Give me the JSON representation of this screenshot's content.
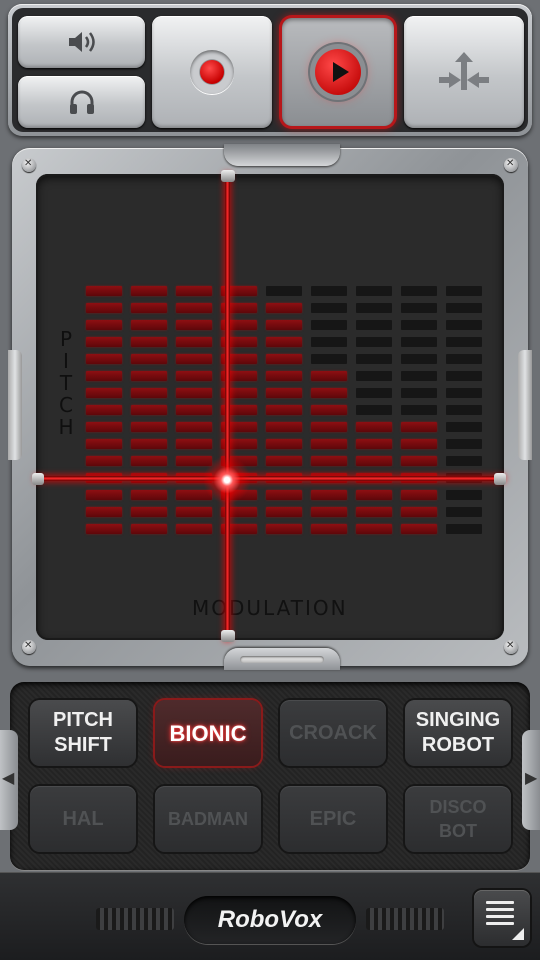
{
  "app": {
    "name": "RoboVox"
  },
  "topbar": {
    "speaker_icon": "speaker-icon",
    "headphones_icon": "headphones-icon",
    "record_icon": "record-icon",
    "play_icon": "play-icon",
    "move_icon": "move-arrows-icon",
    "play_active": true
  },
  "pad": {
    "y_axis_label": "PITCH",
    "x_axis_label": "MODULATION",
    "crosshair": {
      "modulation": 0.41,
      "pitch": 0.35
    },
    "accent_color": "#e01515"
  },
  "equalizer": {
    "columns": 9,
    "rows": 15,
    "levels": [
      15,
      15,
      15,
      15,
      14,
      10,
      7,
      7,
      0
    ]
  },
  "effects": [
    {
      "label": "PITCH\nSHIFT",
      "state": "enabled"
    },
    {
      "label": "BIONIC",
      "state": "selected"
    },
    {
      "label": "CROACK",
      "state": "disabled"
    },
    {
      "label": "SINGING\nROBOT",
      "state": "enabled"
    },
    {
      "label": "HAL",
      "state": "disabled"
    },
    {
      "label": "BADMAN",
      "state": "disabled"
    },
    {
      "label": "EPIC",
      "state": "disabled"
    },
    {
      "label": "DISCO\nBOT",
      "state": "disabled"
    }
  ],
  "bottombar": {
    "logo": "RoboVox",
    "menu_icon": "menu-icon",
    "left_arrow": "◀",
    "right_arrow": "▶"
  }
}
